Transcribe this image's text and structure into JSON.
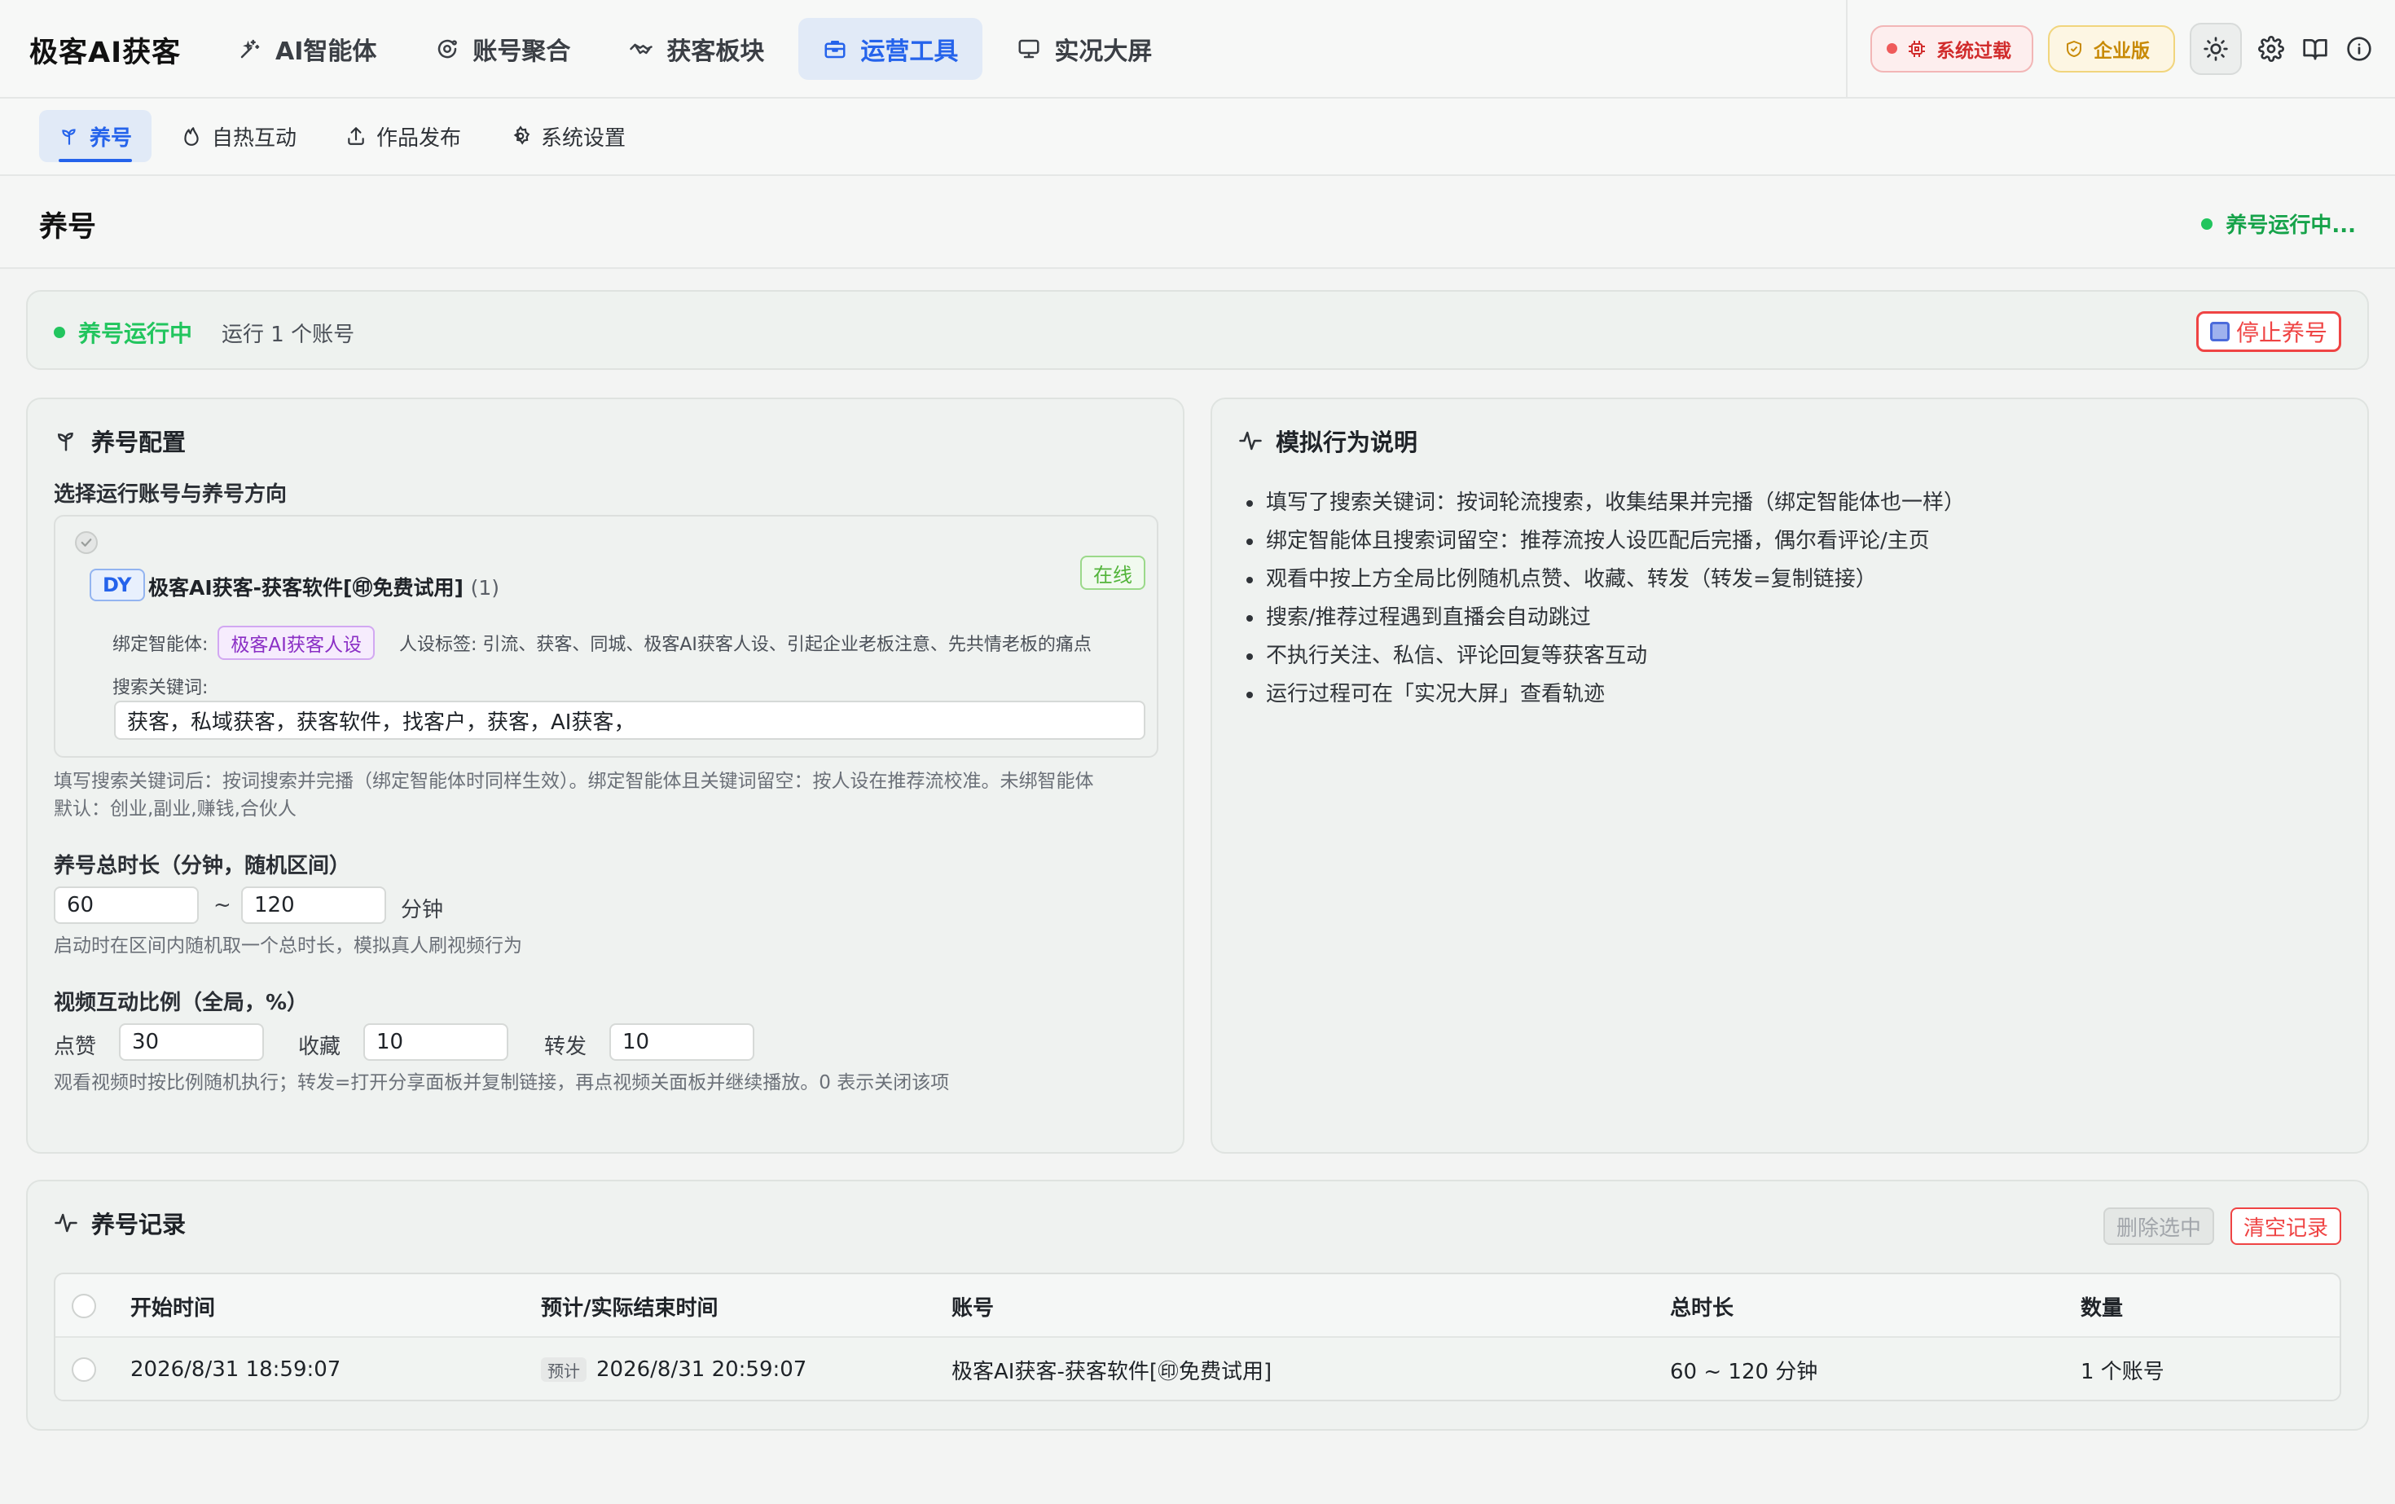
{
  "brand": "极客AI获客",
  "nav": [
    {
      "label": "AI智能体",
      "icon": "sparkle-icon"
    },
    {
      "label": "账号聚合",
      "icon": "orbit-icon"
    },
    {
      "label": "获客板块",
      "icon": "handshake-icon"
    },
    {
      "label": "运营工具",
      "icon": "toolbox-icon",
      "active": true
    },
    {
      "label": "实况大屏",
      "icon": "monitor-icon"
    }
  ],
  "top_right": {
    "overload_label": "系统过载",
    "edition_label": "企业版"
  },
  "subnav": [
    {
      "label": "养号",
      "icon": "sprout-icon",
      "active": true
    },
    {
      "label": "自热互动",
      "icon": "flame-icon"
    },
    {
      "label": "作品发布",
      "icon": "upload-icon"
    },
    {
      "label": "系统设置",
      "icon": "gear-icon"
    }
  ],
  "page": {
    "title": "养号",
    "status": "养号运行中..."
  },
  "banner": {
    "status": "养号运行中",
    "count": "运行 1 个账号",
    "stop_label": "停止养号"
  },
  "config": {
    "title": "养号配置",
    "select_label": "选择运行账号与养号方向",
    "account": {
      "platform": "DY",
      "name": "极客AI获客-获客软件[㊞免费试用]",
      "count": "(1)",
      "status": "在线",
      "bind_label": "绑定智能体:",
      "persona": "极客AI获客人设",
      "tags": "人设标签: 引流、获客、同城、极客AI获客人设、引起企业老板注意、先共情老板的痛点",
      "keyword_label": "搜索关键词:",
      "keywords": "获客，私域获客，获客软件，找客户，获客，AI获客，"
    },
    "keyword_hint_1": "填写搜索关键词后：按词搜索并完播（绑定智能体时同样生效）。绑定智能体且关键词留空：按人设在推荐流校准。未绑智能体",
    "keyword_hint_2": "默认：创业,副业,赚钱,合伙人",
    "duration_label": "养号总时长（分钟，随机区间）",
    "duration_min": "60",
    "duration_tilde": "~",
    "duration_max": "120",
    "duration_unit": "分钟",
    "duration_hint": "启动时在区间内随机取一个总时长，模拟真人刷视频行为",
    "ratio_label": "视频互动比例（全局，%）",
    "like_label": "点赞",
    "like_value": "30",
    "fav_label": "收藏",
    "fav_value": "10",
    "share_label": "转发",
    "share_value": "10",
    "ratio_hint": "观看视频时按比例随机执行；转发=打开分享面板并复制链接，再点视频关面板并继续播放。0 表示关闭该项"
  },
  "explain": {
    "title": "模拟行为说明",
    "items": [
      "填写了搜索关键词：按词轮流搜索，收集结果并完播（绑定智能体也一样）",
      "绑定智能体且搜索词留空：推荐流按人设匹配后完播，偶尔看评论/主页",
      "观看中按上方全局比例随机点赞、收藏、转发（转发=复制链接）",
      "搜索/推荐过程遇到直播会自动跳过",
      "不执行关注、私信、评论回复等获客互动",
      "运行过程可在「实况大屏」查看轨迹"
    ]
  },
  "records": {
    "title": "养号记录",
    "delete_label": "删除选中",
    "clear_label": "清空记录",
    "columns": [
      "开始时间",
      "预计/实际结束时间",
      "账号",
      "总时长",
      "数量"
    ],
    "rows": [
      {
        "start": "2026/8/31 18:59:07",
        "end_tag": "预计",
        "end": "2026/8/31 20:59:07",
        "account": "极客AI获客-获客软件[㊞免费试用]",
        "duration": "60 ~ 120 分钟",
        "count": "1 个账号"
      }
    ]
  },
  "colors": {
    "accent": "#2563eb",
    "running": "#22c55e",
    "danger": "#ef4444",
    "warning": "#c88a06"
  }
}
